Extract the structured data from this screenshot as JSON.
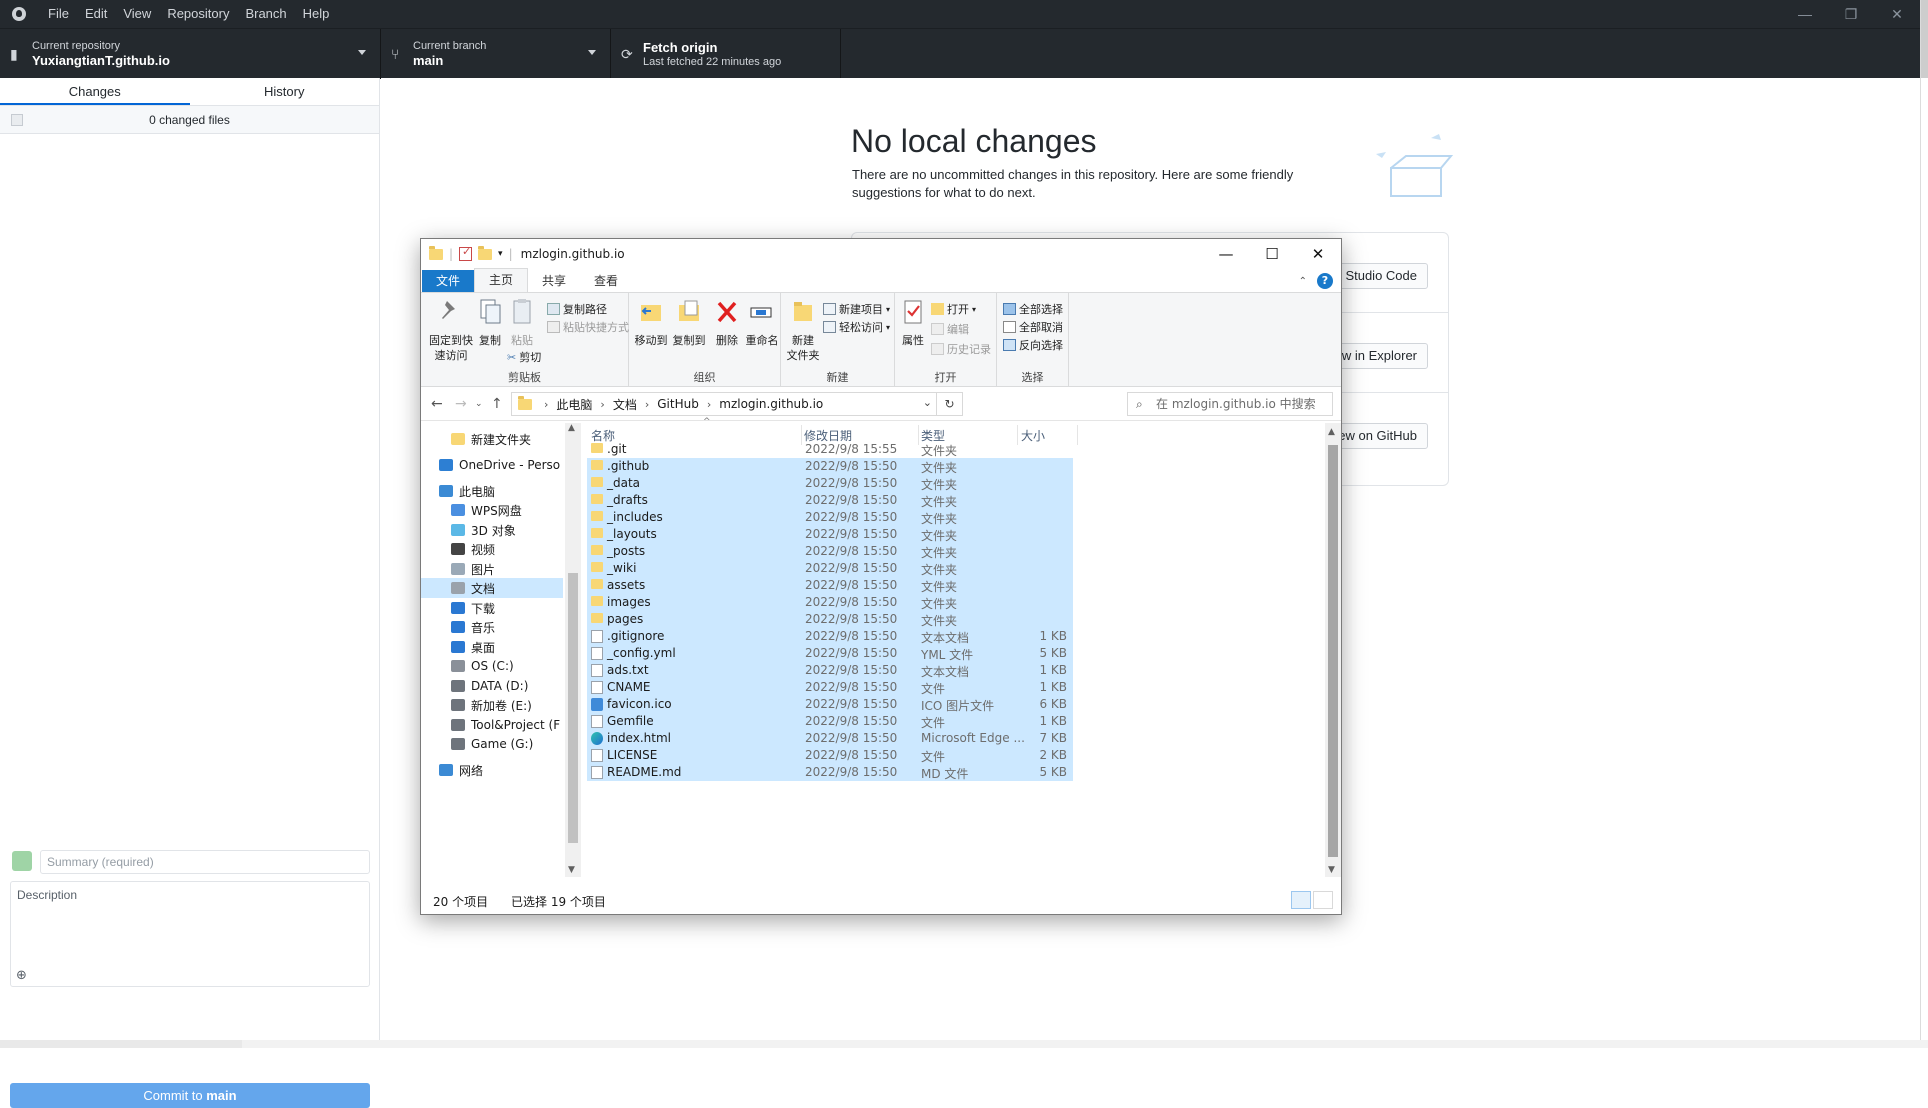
{
  "app": {
    "menu": [
      "File",
      "Edit",
      "View",
      "Repository",
      "Branch",
      "Help"
    ],
    "window_controls": [
      "—",
      "❐",
      "✕"
    ]
  },
  "toolbar": {
    "repo_desc": "Current repository",
    "repo_name": "YuxiangtianT.github.io",
    "branch_desc": "Current branch",
    "branch_name": "main",
    "fetch_title": "Fetch origin",
    "fetch_desc": "Last fetched 22 minutes ago"
  },
  "left": {
    "tabs": [
      "Changes",
      "History"
    ],
    "changed_files": "0 changed files",
    "summary_placeholder": "Summary (required)",
    "description_placeholder": "Description",
    "commit_prefix": "Commit to ",
    "commit_branch": "main"
  },
  "main": {
    "title": "No local changes",
    "text": "There are no uncommitted changes in this repository. Here are some friendly suggestions for what to do next.",
    "suggestion_buttons": [
      "Studio Code",
      "w in Explorer",
      "ew on GitHub"
    ]
  },
  "explorer": {
    "title": "mzlogin.github.io",
    "ribbon_tabs": [
      "文件",
      "主页",
      "共享",
      "查看"
    ],
    "ribbon": {
      "clipboard": {
        "pin": "固定到快\n速访问",
        "copy": "复制",
        "paste": "粘贴",
        "copy_path": "复制路径",
        "paste_shortcut": "粘贴快捷方式",
        "cut": "剪切",
        "label": "剪贴板"
      },
      "organize": {
        "move_to": "移动到",
        "copy_to": "复制到",
        "delete": "删除",
        "rename": "重命名",
        "label": "组织"
      },
      "new": {
        "new_folder": "新建\n文件夹",
        "new_item": "新建项目",
        "easy_access": "轻松访问",
        "label": "新建"
      },
      "open": {
        "properties": "属性",
        "open": "打开",
        "edit": "编辑",
        "history": "历史记录",
        "label": "打开"
      },
      "select": {
        "select_all": "全部选择",
        "select_none": "全部取消",
        "invert": "反向选择",
        "label": "选择"
      }
    },
    "breadcrumbs": [
      "此电脑",
      "文档",
      "GitHub",
      "mzlogin.github.io"
    ],
    "search_placeholder": "在 mzlogin.github.io 中搜索",
    "tree": [
      {
        "label": "新建文件夹",
        "color": "#f8d775"
      },
      {
        "label": "OneDrive - Perso",
        "color": "#2d7fd3"
      },
      {
        "label": "此电脑",
        "color": "#3b8ad4"
      },
      {
        "label": "WPS网盘",
        "color": "#4a8fe0"
      },
      {
        "label": "3D 对象",
        "color": "#5bb8e6"
      },
      {
        "label": "视频",
        "color": "#444"
      },
      {
        "label": "图片",
        "color": "#9aa9b7"
      },
      {
        "label": "文档",
        "color": "#9aa2ab"
      },
      {
        "label": "下载",
        "color": "#2a78d2"
      },
      {
        "label": "音乐",
        "color": "#2a78d2"
      },
      {
        "label": "桌面",
        "color": "#2a78d2"
      },
      {
        "label": "OS (C:)",
        "color": "#8a9099"
      },
      {
        "label": "DATA (D:)",
        "color": "#6e747c"
      },
      {
        "label": "新加卷 (E:)",
        "color": "#6e747c"
      },
      {
        "label": "Tool&Project (F",
        "color": "#6e747c"
      },
      {
        "label": "Game (G:)",
        "color": "#6e747c"
      },
      {
        "label": "网络",
        "color": "#3b8ad4"
      }
    ],
    "columns": [
      "名称",
      "修改日期",
      "类型",
      "大小"
    ],
    "files": [
      {
        "name": ".git",
        "date": "2022/9/8 15:55",
        "type": "文件夹",
        "size": "",
        "icon": "folder",
        "selected": false
      },
      {
        "name": ".github",
        "date": "2022/9/8 15:50",
        "type": "文件夹",
        "size": "",
        "icon": "folder",
        "selected": true
      },
      {
        "name": "_data",
        "date": "2022/9/8 15:50",
        "type": "文件夹",
        "size": "",
        "icon": "folder",
        "selected": true
      },
      {
        "name": "_drafts",
        "date": "2022/9/8 15:50",
        "type": "文件夹",
        "size": "",
        "icon": "folder",
        "selected": true
      },
      {
        "name": "_includes",
        "date": "2022/9/8 15:50",
        "type": "文件夹",
        "size": "",
        "icon": "folder",
        "selected": true
      },
      {
        "name": "_layouts",
        "date": "2022/9/8 15:50",
        "type": "文件夹",
        "size": "",
        "icon": "folder",
        "selected": true
      },
      {
        "name": "_posts",
        "date": "2022/9/8 15:50",
        "type": "文件夹",
        "size": "",
        "icon": "folder",
        "selected": true
      },
      {
        "name": "_wiki",
        "date": "2022/9/8 15:50",
        "type": "文件夹",
        "size": "",
        "icon": "folder",
        "selected": true
      },
      {
        "name": "assets",
        "date": "2022/9/8 15:50",
        "type": "文件夹",
        "size": "",
        "icon": "folder",
        "selected": true
      },
      {
        "name": "images",
        "date": "2022/9/8 15:50",
        "type": "文件夹",
        "size": "",
        "icon": "folder",
        "selected": true
      },
      {
        "name": "pages",
        "date": "2022/9/8 15:50",
        "type": "文件夹",
        "size": "",
        "icon": "folder",
        "selected": true
      },
      {
        "name": ".gitignore",
        "date": "2022/9/8 15:50",
        "type": "文本文档",
        "size": "1 KB",
        "icon": "doc",
        "selected": true
      },
      {
        "name": "_config.yml",
        "date": "2022/9/8 15:50",
        "type": "YML 文件",
        "size": "5 KB",
        "icon": "doc",
        "selected": true
      },
      {
        "name": "ads.txt",
        "date": "2022/9/8 15:50",
        "type": "文本文档",
        "size": "1 KB",
        "icon": "doc",
        "selected": true
      },
      {
        "name": "CNAME",
        "date": "2022/9/8 15:50",
        "type": "文件",
        "size": "1 KB",
        "icon": "doc",
        "selected": true
      },
      {
        "name": "favicon.ico",
        "date": "2022/9/8 15:50",
        "type": "ICO 图片文件",
        "size": "6 KB",
        "icon": "img",
        "selected": true
      },
      {
        "name": "Gemfile",
        "date": "2022/9/8 15:50",
        "type": "文件",
        "size": "1 KB",
        "icon": "doc",
        "selected": true
      },
      {
        "name": "index.html",
        "date": "2022/9/8 15:50",
        "type": "Microsoft Edge ...",
        "size": "7 KB",
        "icon": "edge",
        "selected": true
      },
      {
        "name": "LICENSE",
        "date": "2022/9/8 15:50",
        "type": "文件",
        "size": "2 KB",
        "icon": "doc",
        "selected": true
      },
      {
        "name": "README.md",
        "date": "2022/9/8 15:50",
        "type": "MD 文件",
        "size": "5 KB",
        "icon": "doc",
        "selected": true
      }
    ],
    "status_count": "20 个项目",
    "status_selected": "已选择 19 个项目"
  }
}
